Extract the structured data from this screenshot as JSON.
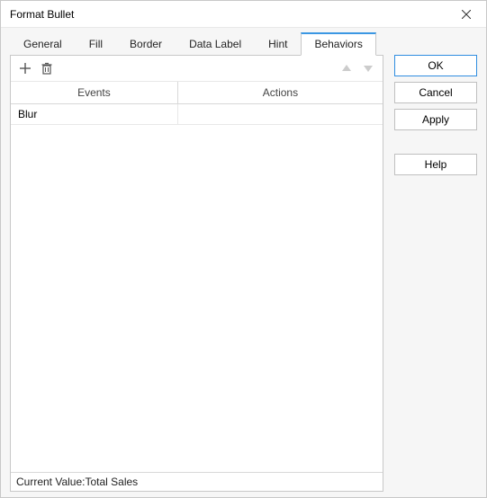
{
  "window": {
    "title": "Format Bullet"
  },
  "tabs": [
    {
      "label": "General"
    },
    {
      "label": "Fill"
    },
    {
      "label": "Border"
    },
    {
      "label": "Data Label"
    },
    {
      "label": "Hint"
    },
    {
      "label": "Behaviors",
      "active": true
    }
  ],
  "grid": {
    "headers": {
      "events": "Events",
      "actions": "Actions"
    },
    "rows": [
      {
        "event": "Blur",
        "action": ""
      }
    ]
  },
  "status": {
    "label": "Current Value:",
    "value": "Total Sales"
  },
  "buttons": {
    "ok": "OK",
    "cancel": "Cancel",
    "apply": "Apply",
    "help": "Help"
  }
}
